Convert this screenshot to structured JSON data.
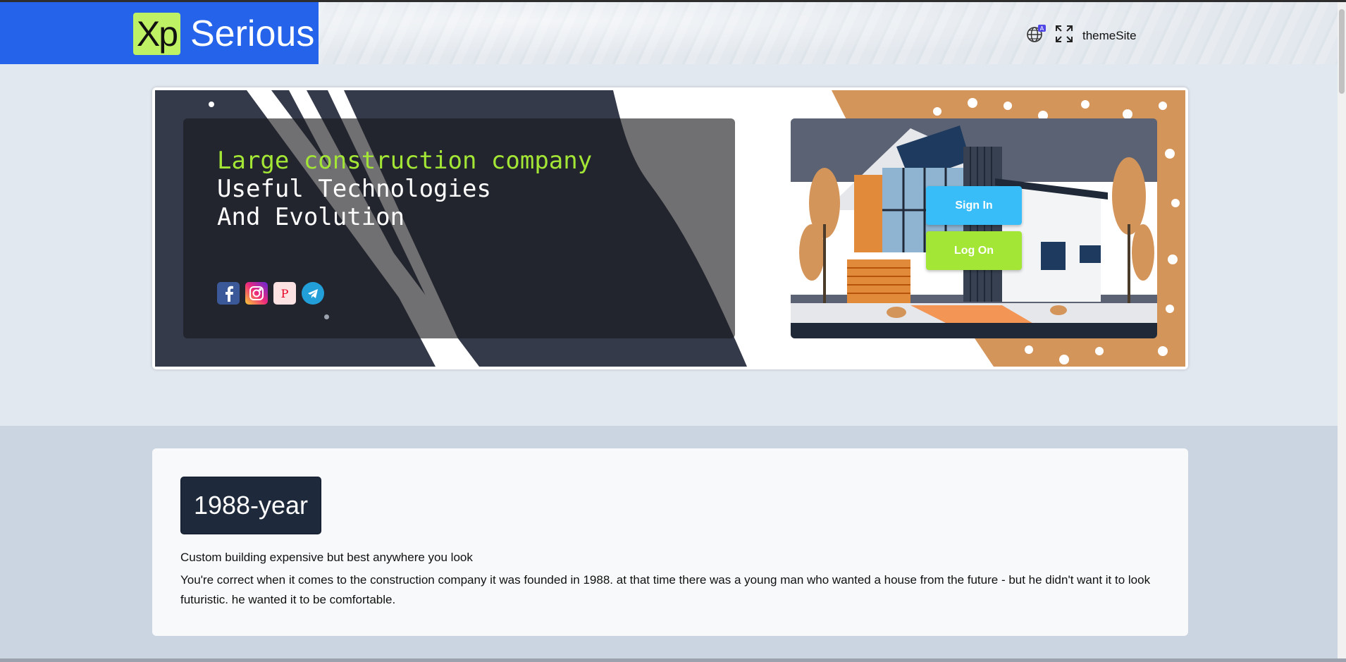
{
  "header": {
    "brand_badge": "Xp",
    "brand_name": "Serious",
    "icons": [
      "language-globe-icon",
      "fullscreen-icon"
    ],
    "theme_label": "themeSite",
    "brand_color": "#2563eb",
    "badge_color": "#bef264"
  },
  "hero": {
    "line1": "Large construction company",
    "line2": "Useful Technologies",
    "line3": "And Evolution",
    "line1_color": "#a3e635",
    "socials": [
      "facebook-icon",
      "instagram-icon",
      "pinterest-icon",
      "telegram-icon"
    ],
    "sign_in_label": "Sign In",
    "log_on_label": "Log On",
    "accent_orange": "#d4955a"
  },
  "info": {
    "year_label": "1988-year",
    "title": "Custom building expensive but best anywhere you look",
    "body": "You're correct when it comes to the construction company it was founded in 1988. at that time there was a young man who wanted a house from the future - but he didn't want it to look futuristic. he wanted it to be comfortable."
  }
}
